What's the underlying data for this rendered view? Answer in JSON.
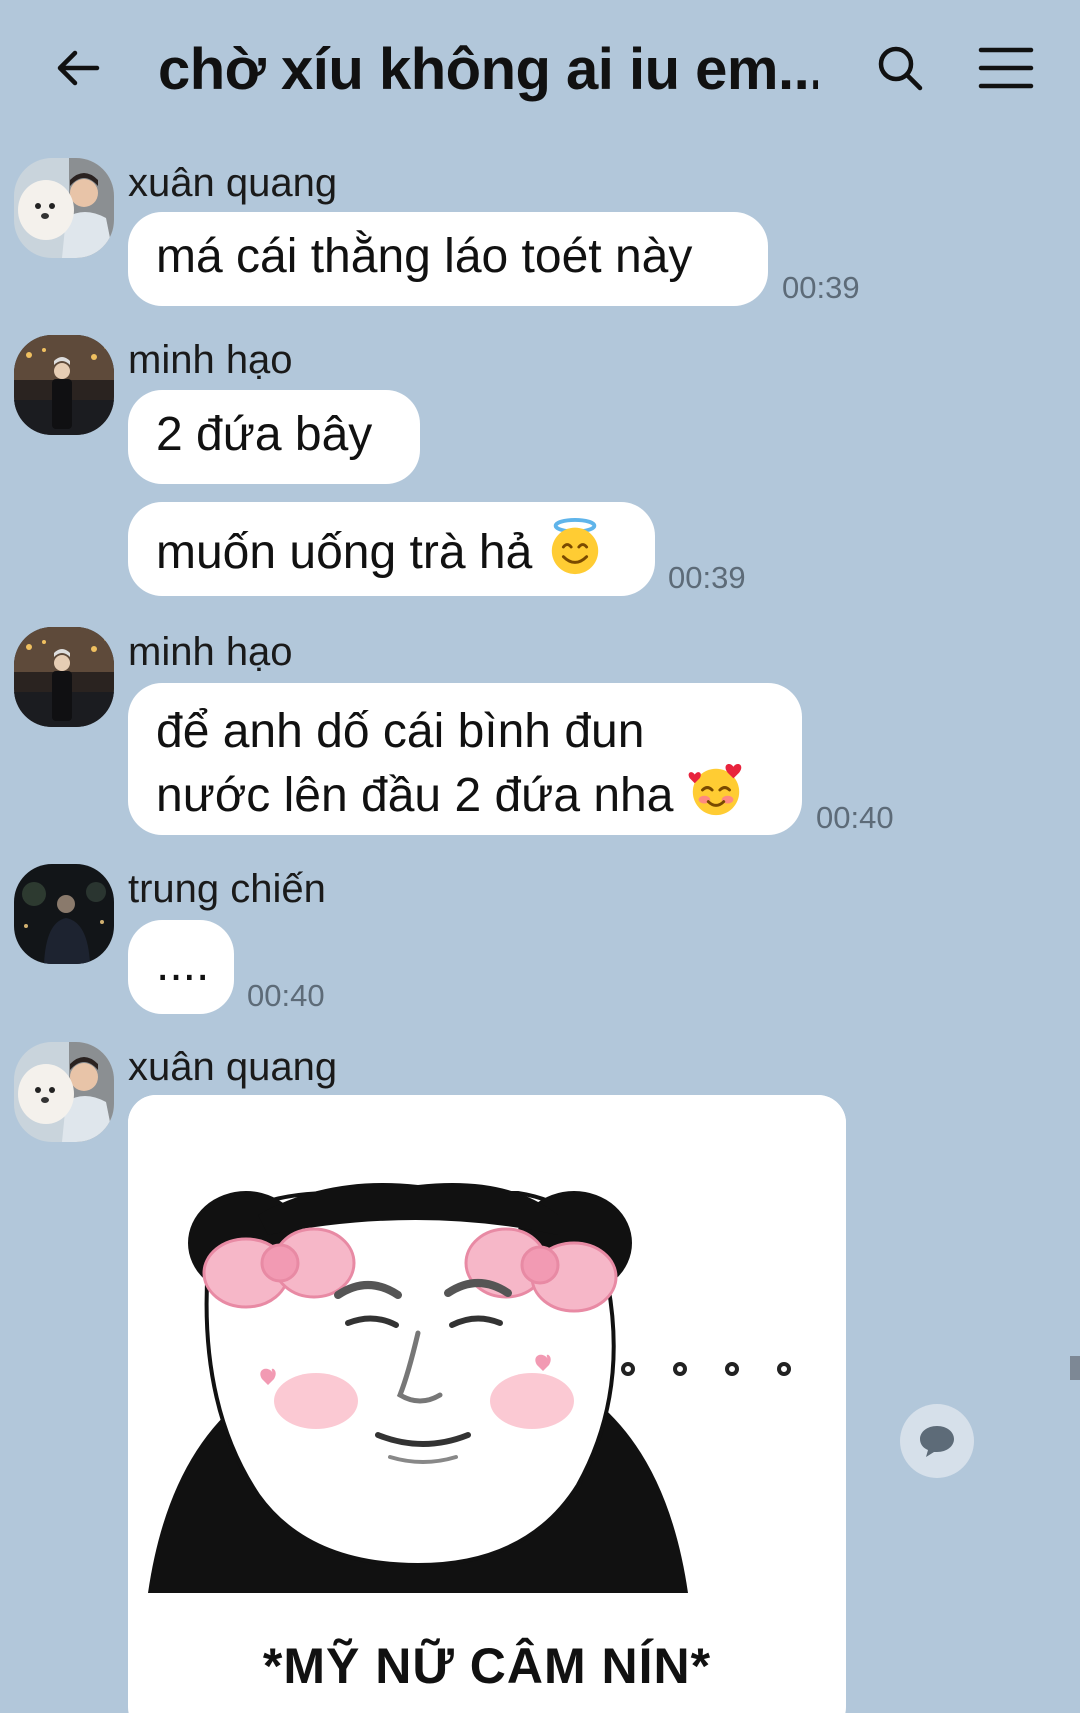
{
  "header": {
    "title": "chờ xíu không ai iu em...",
    "back_icon": "arrow-left-icon",
    "search_icon": "search-icon",
    "menu_icon": "hamburger-menu-icon"
  },
  "messages": [
    {
      "sender": "xuân quang",
      "text": "má cái thằng láo toét này",
      "time": "00:39"
    },
    {
      "sender": "minh hạo",
      "text": "2 đứa bây"
    },
    {
      "text": "muốn uống trà hả",
      "emoji": "halo-smile-emoji",
      "time": "00:39"
    },
    {
      "sender": "minh hạo",
      "text_line1": "để anh dố cái bình đun",
      "text_line2": "nước lên đầu 2 đứa nha",
      "emoji": "smiling-face-with-hearts-emoji",
      "time": "00:40"
    },
    {
      "sender": "trung chiến",
      "text": "....",
      "time": "00:40"
    },
    {
      "sender": "xuân quang",
      "sticker": {
        "caption": "*MỸ NỮ CÂM NÍN*",
        "description": "panda-meme-sticker"
      }
    }
  ],
  "colors": {
    "background": "#b2c7da",
    "bubble": "#ffffff",
    "time_text": "#5d6b78"
  }
}
